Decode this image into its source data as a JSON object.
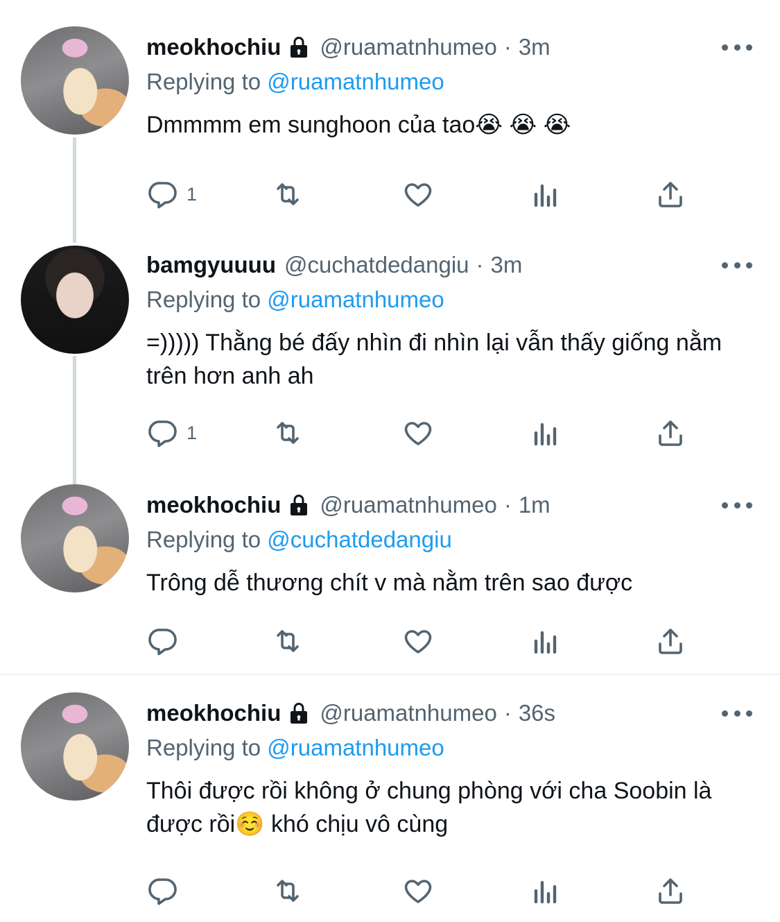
{
  "tweets": [
    {
      "name": "meokhochiu",
      "handle": "@ruamatnhumeo",
      "dot": "·",
      "time": "3m",
      "replying_prefix": "Replying to ",
      "replying_to": "@ruamatnhumeo",
      "text": "Dmmmm em sunghoon của tao😭 😭 😭",
      "reply_count": "1"
    },
    {
      "name": "bamgyuuuu",
      "handle": "@cuchatdedangiu",
      "dot": "·",
      "time": "3m",
      "replying_prefix": "Replying to ",
      "replying_to": "@ruamatnhumeo",
      "text": "=))))) Thằng bé đấy nhìn đi nhìn lại vẫn thấy giống nằm trên hơn anh ah",
      "reply_count": "1"
    },
    {
      "name": "meokhochiu",
      "handle": "@ruamatnhumeo",
      "dot": "·",
      "time": "1m",
      "replying_prefix": "Replying to ",
      "replying_to": "@cuchatdedangiu",
      "text": "Trông dễ thương chít v mà nằm trên sao được",
      "reply_count": ""
    },
    {
      "name": "meokhochiu",
      "handle": "@ruamatnhumeo",
      "dot": "·",
      "time": "36s",
      "replying_prefix": "Replying to ",
      "replying_to": "@ruamatnhumeo",
      "text": "Thôi được rồi không ở chung phòng với cha Soobin là được rồi☺️ khó chịu vô cùng",
      "reply_count": ""
    }
  ],
  "icons": {
    "lock": "lock-icon",
    "more": "more-icon",
    "reply": "reply-icon",
    "retweet": "retweet-icon",
    "like": "like-icon",
    "analytics": "analytics-icon",
    "share": "share-icon"
  },
  "colors": {
    "link": "#1d9bf0",
    "secondary": "#536471",
    "thread_line": "#cfd9de"
  }
}
